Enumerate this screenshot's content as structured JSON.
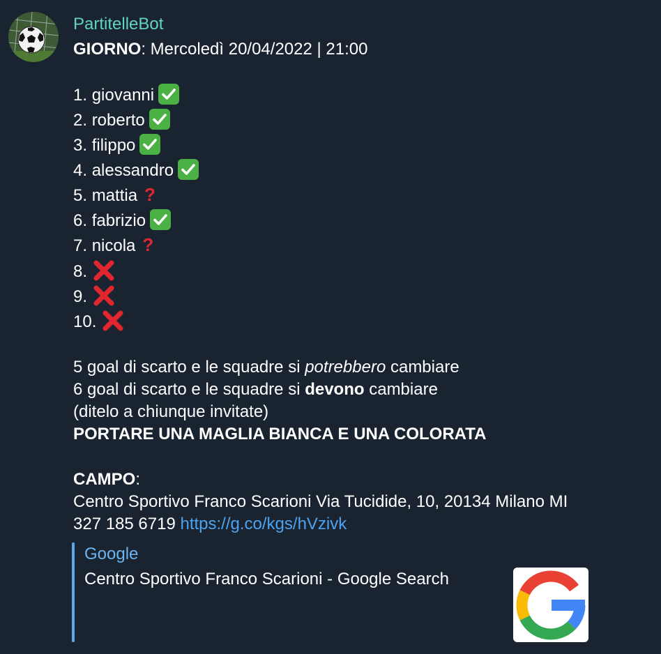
{
  "sender": "PartitelleBot",
  "header": {
    "label": "GIORNO",
    "value": ": Mercoledì 20/04/2022 | 21:00"
  },
  "players": [
    {
      "n": "1.",
      "name": "giovanni",
      "status": "confirmed"
    },
    {
      "n": "2.",
      "name": "roberto",
      "status": "confirmed"
    },
    {
      "n": "3.",
      "name": "filippo",
      "status": "confirmed"
    },
    {
      "n": "4.",
      "name": "alessandro",
      "status": "confirmed"
    },
    {
      "n": "5.",
      "name": "mattia",
      "status": "maybe"
    },
    {
      "n": "6.",
      "name": "fabrizio",
      "status": "confirmed"
    },
    {
      "n": "7.",
      "name": "nicola",
      "status": "maybe"
    },
    {
      "n": "8.",
      "name": "",
      "status": "open"
    },
    {
      "n": "9.",
      "name": "",
      "status": "open"
    },
    {
      "n": "10.",
      "name": "",
      "status": "open"
    }
  ],
  "rules": {
    "r1_pre": "5 goal di scarto e le squadre si ",
    "r1_em": "potrebbero",
    "r1_post": " cambiare",
    "r2_pre": "6 goal di scarto e le squadre si ",
    "r2_bold": "devono",
    "r2_post": " cambiare",
    "r3": "(ditelo a chiunque invitate)",
    "r4": "PORTARE UNA MAGLIA BIANCA E UNA COLORATA"
  },
  "campo": {
    "label": "CAMPO",
    "colon": ":",
    "address": "Centro Sportivo Franco Scarioni Via Tucidide, 10, 20134 Milano MI",
    "phone": "327 185 6719 ",
    "link": "https://g.co/kgs/hVzivk"
  },
  "preview": {
    "site": "Google",
    "title": "Centro Sportivo Franco Scarioni - Google Search"
  },
  "icons": {
    "confirmed": "check-mark-icon",
    "maybe": "question-mark-icon",
    "open": "cross-mark-icon"
  },
  "colors": {
    "background": "#1a2431",
    "sender": "#62d3c0",
    "link": "#4ba3f0",
    "check": "#4cb144",
    "cross": "#e0262f"
  }
}
